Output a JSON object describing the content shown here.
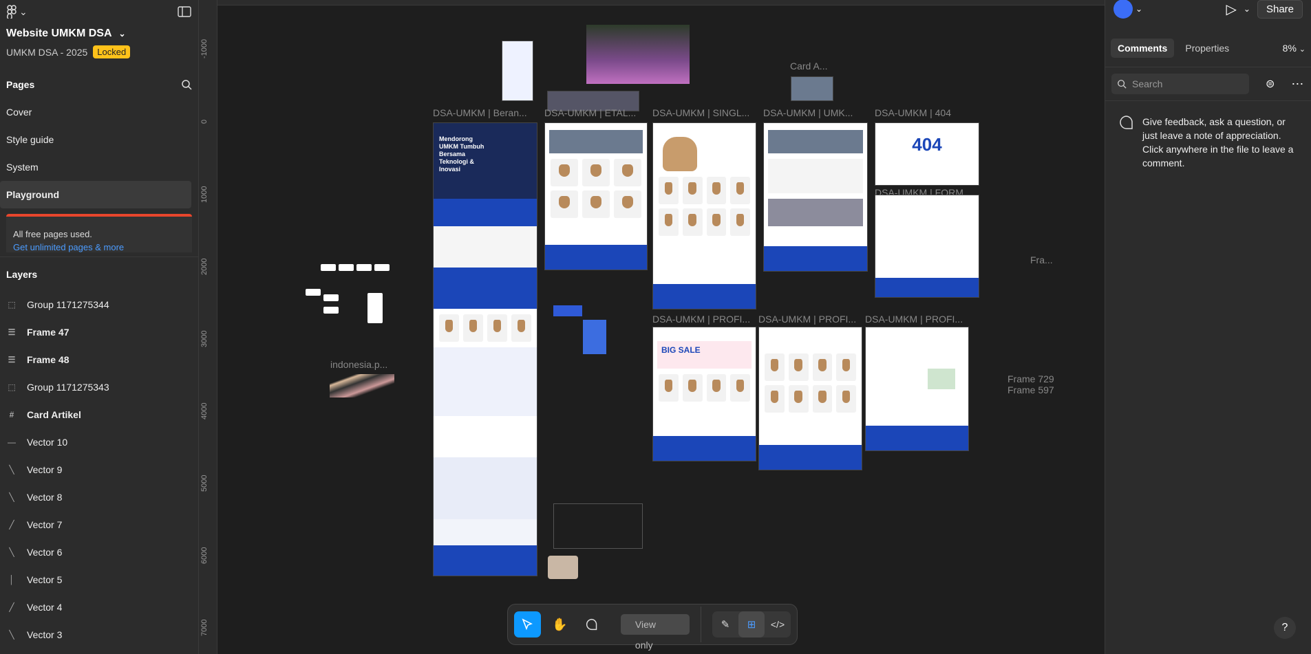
{
  "file": {
    "title": "Website UMKM DSA",
    "project": "UMKM DSA - 2025",
    "status_badge": "Locked"
  },
  "pages": {
    "heading": "Pages",
    "items": [
      {
        "label": "Cover"
      },
      {
        "label": "Style guide"
      },
      {
        "label": "System"
      },
      {
        "label": "Playground"
      }
    ],
    "upsell_text": "All free pages used.",
    "upsell_link": "Get unlimited pages & more"
  },
  "layers": {
    "heading": "Layers",
    "items": [
      {
        "label": "Group 1171275344",
        "icon": "group-icon"
      },
      {
        "label": "Frame 47",
        "icon": "autolayout-icon"
      },
      {
        "label": "Frame 48",
        "icon": "autolayout-icon"
      },
      {
        "label": "Group 1171275343",
        "icon": "group-icon"
      },
      {
        "label": "Card Artikel",
        "icon": "frame-icon"
      },
      {
        "label": "Vector 10",
        "icon": "vector-icon"
      },
      {
        "label": "Vector 9",
        "icon": "vector-icon"
      },
      {
        "label": "Vector 8",
        "icon": "vector-icon"
      },
      {
        "label": "Vector 7",
        "icon": "vector-icon"
      },
      {
        "label": "Vector 6",
        "icon": "vector-icon"
      },
      {
        "label": "Vector 5",
        "icon": "vector-icon"
      },
      {
        "label": "Vector 4",
        "icon": "vector-icon"
      },
      {
        "label": "Vector 3",
        "icon": "vector-icon"
      }
    ]
  },
  "ruler": {
    "marks": [
      "-1000",
      "0",
      "1000",
      "2000",
      "3000",
      "4000",
      "5000",
      "6000",
      "7000"
    ]
  },
  "canvas": {
    "labels": {
      "beranda": "DSA-UMKM | Beran...",
      "etalase": "DSA-UMKM | ETAL...",
      "single": "DSA-UMKM | SINGL...",
      "umkm": "DSA-UMKM | UMK...",
      "e404": "DSA-UMKM | 404",
      "form": "DSA-UMKM | FORM...",
      "profil1": "DSA-UMKM | PROFI...",
      "profil2": "DSA-UMKM | PROFI...",
      "profil3": "DSA-UMKM | PROFI...",
      "card": "Card A...",
      "indonesia": "indonesia.p...",
      "fra": "Fra...",
      "frame729": "Frame 729",
      "frame597": "Frame 597"
    },
    "hero_text": "Mendorong UMKM Tumbuh Bersama Teknologi & Inovasi",
    "big_sale": "BIG SALE",
    "text_404": "404"
  },
  "right_panel": {
    "share": "Share",
    "tabs": [
      "Comments",
      "Properties"
    ],
    "zoom": "8%",
    "search_placeholder": "Search",
    "feedback": "Give feedback, ask a question, or just leave a note of appreciation. Click anywhere in the file to leave a comment.",
    "help": "?"
  },
  "toolbar": {
    "view_only": "View only"
  },
  "colors": {
    "accent": "#0d99ff",
    "locked_badge": "#ffc21a",
    "brand_blue": "#1b46b8",
    "upsell_bar": "#e8462c"
  }
}
